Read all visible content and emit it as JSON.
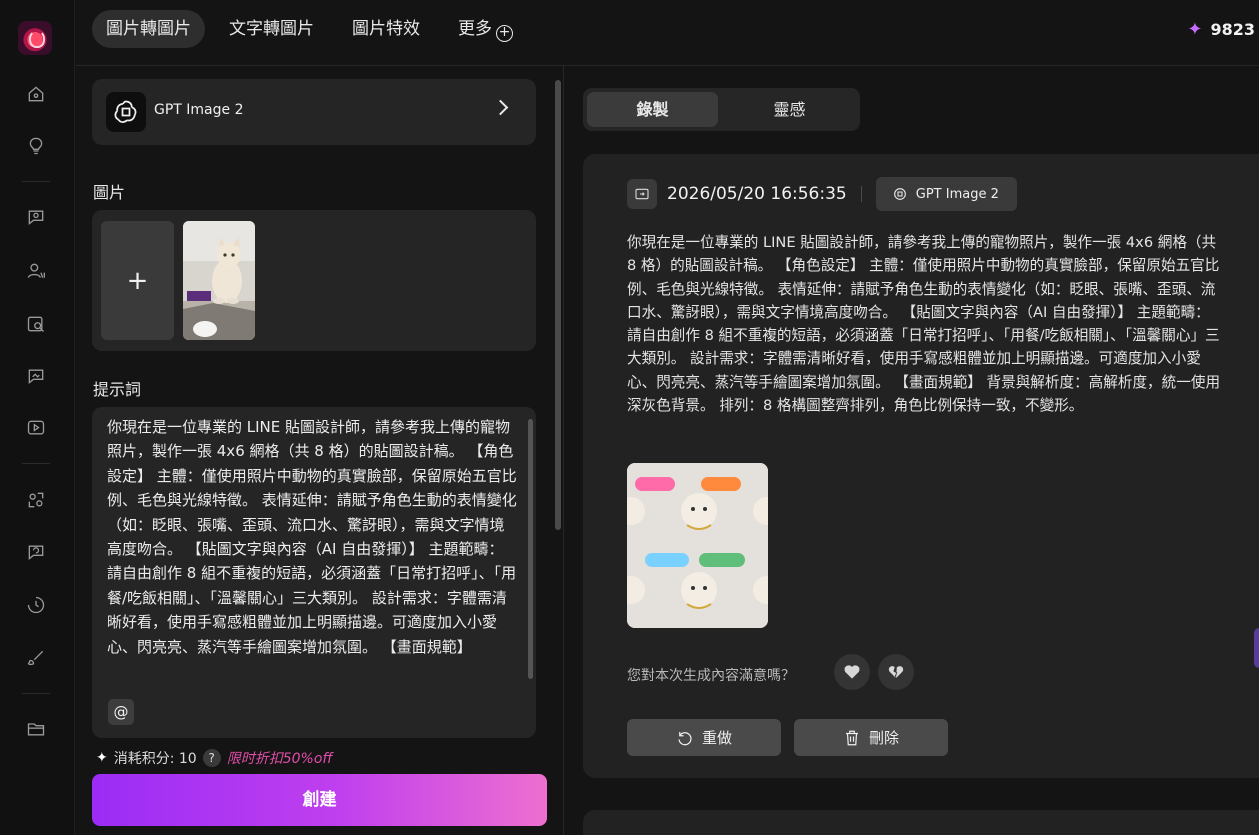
{
  "topbar": {
    "tabs": [
      {
        "label": "圖片轉圖片",
        "active": true
      },
      {
        "label": "文字轉圖片",
        "active": false
      },
      {
        "label": "圖片特效",
        "active": false
      },
      {
        "label": "更多",
        "active": false
      }
    ],
    "more_icon": "plus-circle-icon",
    "credits": "9823",
    "credits_icon": "sparkle-icon"
  },
  "rail": {
    "items": [
      "home-icon",
      "lightbulb-icon",
      "chat-image-icon",
      "ai-avatar-icon",
      "image-search-icon",
      "chat-image-icon",
      "video-icon",
      "face-swap-icon",
      "chat-refresh-icon",
      "history-icon",
      "brush-icon",
      "folder-icon"
    ]
  },
  "left": {
    "model": {
      "name": "GPT Image 2",
      "icon": "openai-icon"
    },
    "image_label": "圖片",
    "add_symbol": "+",
    "prompt_label": "提示詞",
    "prompt_text": "你現在是一位專業的 LINE 貼圖設計師，請參考我上傳的寵物照片，製作一張 4x6 網格（共 8 格）的貼圖設計稿。 【角色設定】 主體：僅使用照片中動物的真實臉部，保留原始五官比例、毛色與光線特徵。 表情延伸：請賦予角色生動的表情變化（如：眨眼、張嘴、歪頭、流口水、驚訝眼），需與文字情境高度吻合。 【貼圖文字與內容（AI 自由發揮）】 主題範疇：請自由創作 8 組不重複的短語，必須涵蓋「日常打招呼」、「用餐/吃飯相關」、「溫馨關心」三大類別。 設計需求：字體需清晰好看，使用手寫感粗體並加上明顯描邊。可適度加入小愛心、閃亮亮、蒸汽等手繪圖案增加氛圍。 【畫面規範】",
    "mention_symbol": "@",
    "cost_label": "消耗积分: 10",
    "help_symbol": "?",
    "promo": "限时折扣50%off",
    "create_label": "創建"
  },
  "right": {
    "segments": [
      {
        "label": "錄製",
        "active": true
      },
      {
        "label": "靈感",
        "active": false
      }
    ],
    "record": {
      "date": "2026/05/20 16:56:35",
      "model": "GPT Image 2",
      "text": "你現在是一位專業的 LINE 貼圖設計師，請參考我上傳的寵物照片，製作一張 4x6 網格（共 8 格）的貼圖設計稿。 【角色設定】 主體：僅使用照片中動物的真實臉部，保留原始五官比例、毛色與光線特徵。 表情延伸：請賦予角色生動的表情變化（如：眨眼、張嘴、歪頭、流口水、驚訝眼），需與文字情境高度吻合。 【貼圖文字與內容（AI 自由發揮）】 主題範疇：請自由創作 8 組不重複的短語，必須涵蓋「日常打招呼」、「用餐/吃飯相關」、「溫馨關心」三大類別。 設計需求：字體需清晰好看，使用手寫感粗體並加上明顯描邊。可適度加入小愛心、閃亮亮、蒸汽等手繪圖案增加氛圍。 【畫面規範】 背景與解析度：高解析度，統一使用深灰色背景。 排列：8 格構圖整齊排列，角色比例保持一致，不變形。",
      "feedback_question": "您對本次生成內容滿意嗎？",
      "redo_label": "重做",
      "delete_label": "刪除"
    }
  },
  "colors": {
    "accent_start": "#9b2cf5",
    "accent_end": "#ee6fcf",
    "promo": "#e14ea9",
    "credits_star": "#c86bff"
  }
}
